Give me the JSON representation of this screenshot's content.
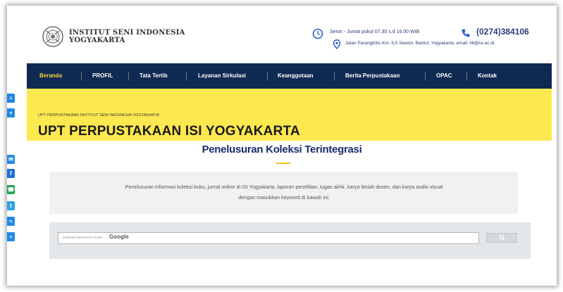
{
  "header": {
    "inst_line1": "INSTITUT SENI INDONESIA",
    "inst_line2": "YOGYAKARTA",
    "hours": "Senin - Jumat pukul 07.30 s.d 16.00 WIB",
    "phone": "(0274)384106",
    "address": "Jalan Parangtritis Km. 6,5 Sewon, Bantul, Yogyakarta. email: lib@isi.ac.id",
    "icons": {
      "logo": "isi-emblem",
      "clock": "clock-icon",
      "phone": "phone-icon",
      "pin": "map-pin-icon"
    }
  },
  "nav": {
    "items": [
      {
        "label": "Beranda",
        "active": true
      },
      {
        "label": "PROFIL"
      },
      {
        "label": "Tata Tertib"
      },
      {
        "label": "Layanan Sirkulasi"
      },
      {
        "label": "Keanggotaan"
      },
      {
        "label": "Berita Perpustakaan"
      },
      {
        "label": "OPAC"
      },
      {
        "label": "Kontak"
      }
    ]
  },
  "banner": {
    "breadcrumb": "UPT PERPUSTAKAAN INSTITUT SENI INDONESIA YOGYAKARTA",
    "title": "UPT PERPUSTAKAAN ISI YOGYAKARTA"
  },
  "section": {
    "title": "Penelusuran Koleksi Terintegrasi",
    "desc_line1": "Penelusuran informasi koleksi buku, jurnal online di ISI Yogyakarta, laporan penelitian, tugas akhir, karya ilmiah dosen, dan karya audio visual",
    "desc_line2": "dengan masukkan keyword di bawah ini:"
  },
  "search": {
    "enhanced_by": "DISEMPURNAKAN OLEH",
    "google": "Google",
    "value": ""
  },
  "social": [
    {
      "name": "share-icon",
      "color": "#1e88e5"
    },
    {
      "name": "plus-icon",
      "color": "#1e88e5"
    },
    {
      "name": "email-icon",
      "color": "#1e88e5"
    },
    {
      "name": "facebook-icon",
      "color": "#1e6fd6"
    },
    {
      "name": "whatsapp-icon",
      "color": "#1fa855"
    },
    {
      "name": "twitter-icon",
      "color": "#2ea3e8"
    },
    {
      "name": "messenger-icon",
      "color": "#1e88e5"
    },
    {
      "name": "share-more-icon",
      "color": "#1e88e5"
    }
  ],
  "colors": {
    "nav_bg": "#0f2a52",
    "banner_bg": "#fce84f",
    "title_blue": "#1c2a6b",
    "active": "#f6d73a"
  }
}
